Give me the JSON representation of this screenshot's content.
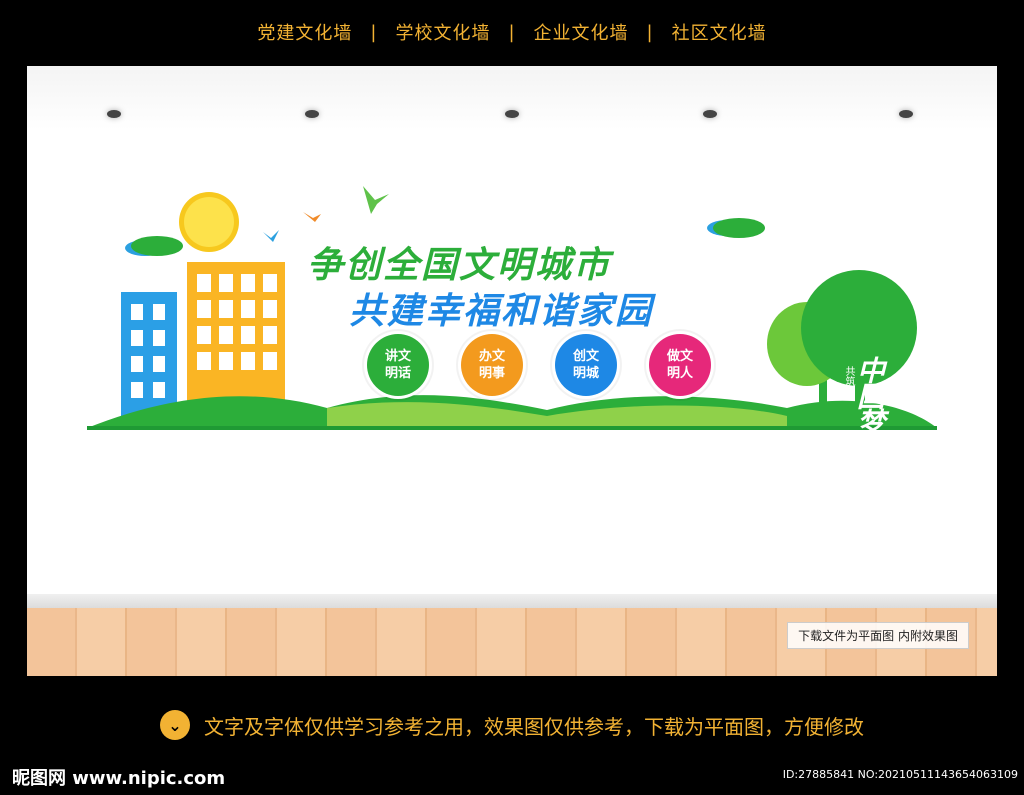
{
  "nav": {
    "items": [
      "党建文化墙",
      "学校文化墙",
      "企业文化墙",
      "社区文化墙"
    ],
    "separator": "|"
  },
  "wall": {
    "slogan_line1": "争创全国文明城市",
    "slogan_line2": "共建幸福和谐家园",
    "badges": [
      {
        "text": "讲文明话",
        "color": "#2cae3a"
      },
      {
        "text": "办文明事",
        "color": "#f39a1e"
      },
      {
        "text": "创文明城",
        "color": "#1e88e5"
      },
      {
        "text": "做文明人",
        "color": "#e6287a"
      }
    ],
    "tree_title": "中国梦",
    "tree_subtitle": "共筑"
  },
  "floor_note": "下载文件为平面图  内附效果图",
  "bottom_notice": "文字及字体仅供学习参考之用，效果图仅供参考，下载为平面图，方便修改",
  "footer": {
    "logo": "昵图网 www.nipic.com",
    "image_id": "ID:27885841 NO:20210511143654063109"
  },
  "colors": {
    "accent": "#f2b233",
    "green": "#2cae3a",
    "blue": "#1e88e5"
  }
}
